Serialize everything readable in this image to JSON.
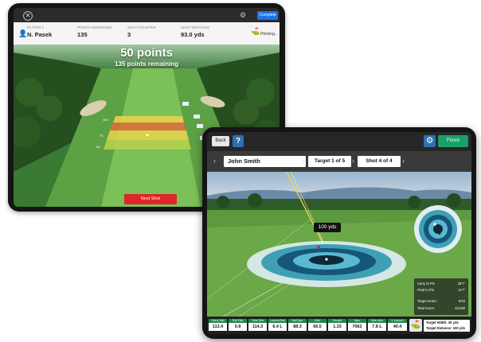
{
  "back_tablet": {
    "stats": [
      {
        "label": "Player 1",
        "value": "N. Pasek"
      },
      {
        "label": "Points Remaining",
        "value": "135"
      },
      {
        "label": "Shot Counter",
        "value": "3"
      },
      {
        "label": "Shot Distance",
        "value": "93.0 yds"
      }
    ],
    "club_label": "Pitching...",
    "complete_button": "Complete",
    "points_title": "50 points",
    "points_remaining": "135 points remaining",
    "next_shot_button": "Next Shot",
    "yardage_markers": [
      "50",
      "75",
      "100"
    ]
  },
  "front_tablet": {
    "back_button": "Back",
    "help_icon": "?",
    "finish_button": "Finish",
    "player_name": "John Smith",
    "target_label": "Target 1 of 5",
    "shot_label": "Shot 4 of 4",
    "distance_flag": "100 yds",
    "panel": {
      "rows": [
        {
          "k": "Carry to Pin",
          "v": "18'7\""
        },
        {
          "k": "Final to Pin",
          "v": "11'7\""
        },
        {
          "k": "Target Score:",
          "v": "9/10"
        },
        {
          "k": "Total Score:",
          "v": "42/180"
        }
      ]
    },
    "stats": [
      {
        "h": "Carry Dist",
        "d": "113.4"
      },
      {
        "h": "Roll Dist",
        "d": "0.9"
      },
      {
        "h": "Total Dist",
        "d": "114.3"
      },
      {
        "h": "Lateral Dist",
        "d": "6.4 L"
      },
      {
        "h": "Ball Spd",
        "d": "88.3"
      },
      {
        "h": "Club",
        "d": "66.5"
      },
      {
        "h": "Smash",
        "d": "1.33"
      },
      {
        "h": "Spin",
        "d": "7062"
      },
      {
        "h": "Spin Axis",
        "d": "7.8 L"
      },
      {
        "h": "V Launch",
        "d": "40.4"
      }
    ],
    "target_info": {
      "width": "Target Width: 30 yds",
      "distance": "Target Distance: 100 yds"
    }
  },
  "colors": {
    "next_shot": "#e0252b",
    "finish": "#18a067",
    "stat_header": "#1f8a4c",
    "accent_blue": "#2e6fb5"
  }
}
